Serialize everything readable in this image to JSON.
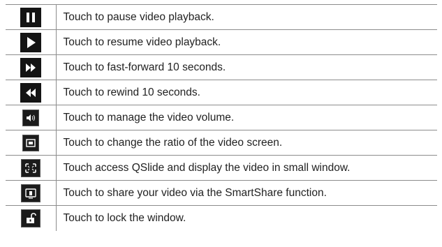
{
  "rows": [
    {
      "icon": "pause-icon",
      "text": "Touch to pause video playback."
    },
    {
      "icon": "play-icon",
      "text": "Touch to resume video playback."
    },
    {
      "icon": "fast-forward-icon",
      "text": "Touch to fast-forward 10 seconds."
    },
    {
      "icon": "rewind-icon",
      "text": "Touch to rewind 10 seconds."
    },
    {
      "icon": "volume-icon",
      "text": "Touch to manage the video volume."
    },
    {
      "icon": "screen-ratio-icon",
      "text": "Touch to change the ratio of the video screen."
    },
    {
      "icon": "qslide-icon",
      "text": "Touch access QSlide and display the video in small window."
    },
    {
      "icon": "smartshare-icon",
      "text": "Touch to share your video via the SmartShare function."
    },
    {
      "icon": "lock-icon",
      "text": "Touch to lock the window."
    }
  ]
}
